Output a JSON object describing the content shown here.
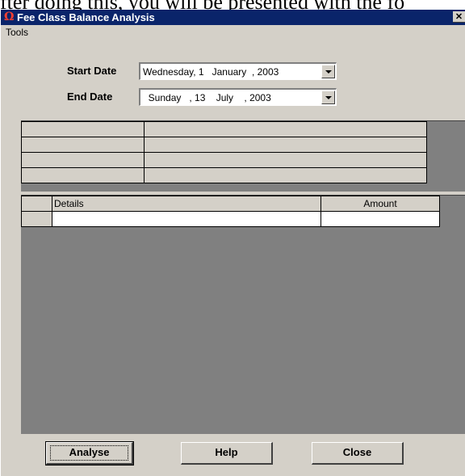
{
  "background_text": "fter doing this, you will be presented with the fo",
  "window": {
    "title": "Fee Class Balance Analysis",
    "close_glyph": "✕"
  },
  "menu": {
    "items": [
      "Tools"
    ]
  },
  "form": {
    "start_date_label": "Start Date",
    "start_date_value": "Wednesday, 1   January  , 2003",
    "end_date_label": "End Date",
    "end_date_value": "  Sunday   , 13    July    , 2003"
  },
  "details_grid": {
    "columns": [
      "Details",
      "Amount"
    ],
    "rows": [
      [
        "",
        ""
      ]
    ]
  },
  "buttons": {
    "analyse": "Analyse",
    "help": "Help",
    "close": "Close"
  },
  "colors": {
    "title_bar": "#0a246a",
    "window_face": "#d4d0c8",
    "panel_gray": "#808080",
    "icon_red": "#ff4030"
  }
}
